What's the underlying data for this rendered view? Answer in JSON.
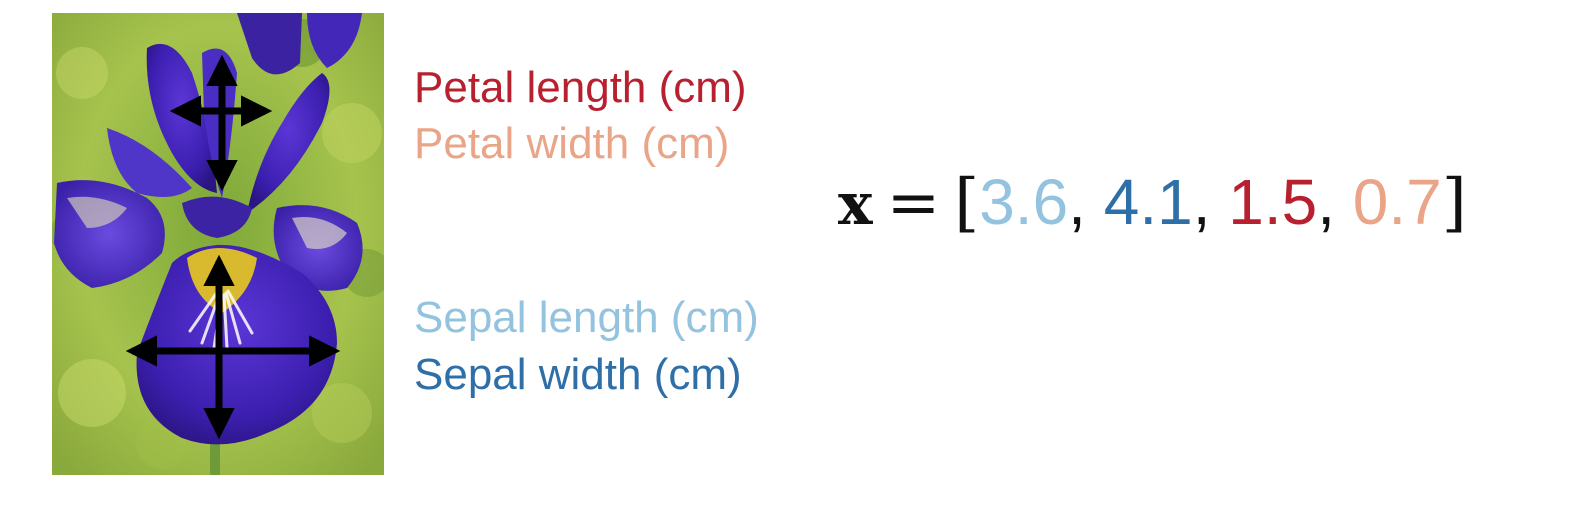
{
  "labels": {
    "petal_length": "Petal length (cm)",
    "petal_width": "Petal width (cm)",
    "sepal_length": "Sepal length (cm)",
    "sepal_width": "Sepal width (cm)"
  },
  "colors": {
    "sepal_length": "#93c3de",
    "sepal_width": "#2f6fa8",
    "petal_length": "#b7202e",
    "petal_width": "#eaa487",
    "text": "#111111"
  },
  "vector": {
    "symbol": "x",
    "equals": "=",
    "open_bracket": "[",
    "close_bracket": "]",
    "separator": ",",
    "values": [
      "3.6",
      "4.1",
      "1.5",
      "0.7"
    ]
  },
  "image": {
    "subject": "iris flower photo with measurement arrows"
  }
}
